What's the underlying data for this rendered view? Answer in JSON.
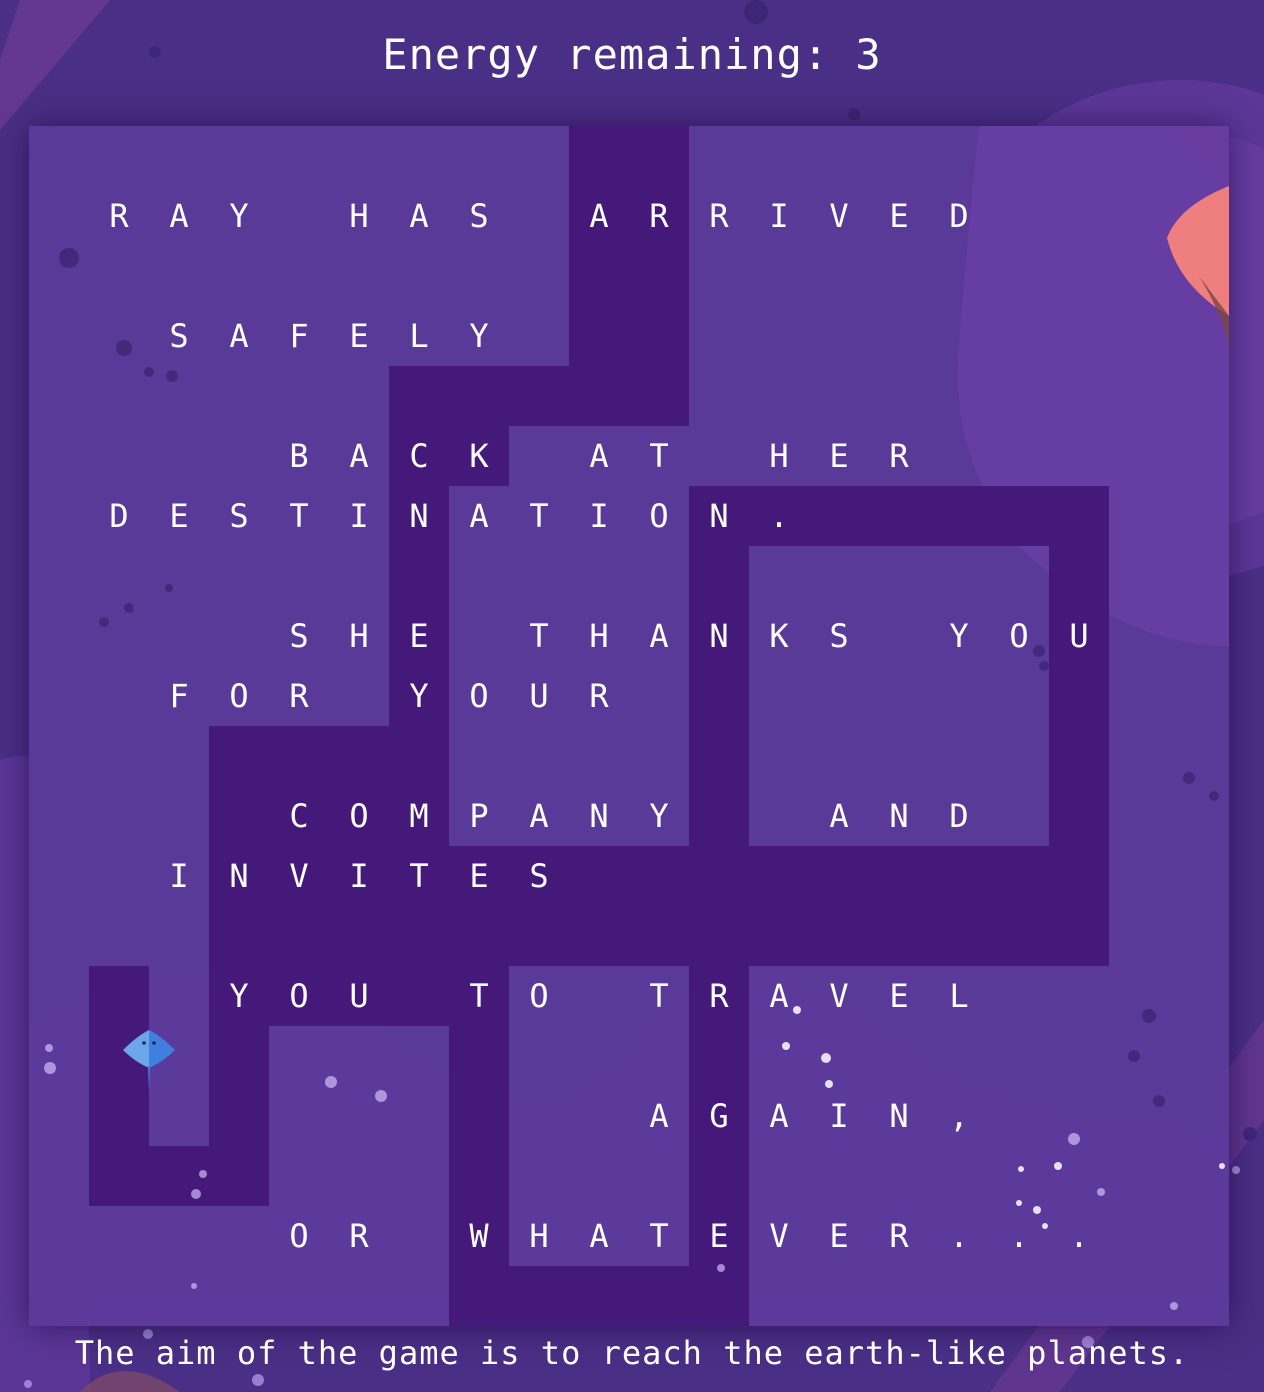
{
  "hud": {
    "energy_text": "Energy remaining: 3"
  },
  "board": {
    "message_lines": [
      {
        "row": 1,
        "col": 1,
        "text": "RAY HAS ARRIVED"
      },
      {
        "row": 3,
        "col": 2,
        "text": "SAFELY"
      },
      {
        "row": 5,
        "col": 4,
        "text": "BACK AT HER"
      },
      {
        "row": 6,
        "col": 1,
        "text": "DESTINATION."
      },
      {
        "row": 8,
        "col": 4,
        "text": "SHE THANKS YOU"
      },
      {
        "row": 9,
        "col": 2,
        "text": "FOR YOUR"
      },
      {
        "row": 11,
        "col": 4,
        "text": "COMPANY  AND"
      },
      {
        "row": 12,
        "col": 2,
        "text": "INVITES"
      },
      {
        "row": 14,
        "col": 3,
        "text": "YOU TO TRAVEL"
      },
      {
        "row": 16,
        "col": 10,
        "text": "AGAIN,"
      },
      {
        "row": 18,
        "col": 4,
        "text": "OR WHATEVER..."
      }
    ],
    "path_cells": [
      [
        9,
        0
      ],
      [
        10,
        0
      ],
      [
        9,
        1
      ],
      [
        10,
        1
      ],
      [
        9,
        2
      ],
      [
        10,
        2
      ],
      [
        9,
        3
      ],
      [
        10,
        3
      ],
      [
        9,
        4
      ],
      [
        10,
        4
      ],
      [
        6,
        4
      ],
      [
        7,
        4
      ],
      [
        8,
        4
      ],
      [
        6,
        5
      ],
      [
        7,
        5
      ],
      [
        6,
        6
      ],
      [
        6,
        7
      ],
      [
        6,
        8
      ],
      [
        6,
        9
      ],
      [
        6,
        10
      ],
      [
        6,
        11
      ],
      [
        3,
        10
      ],
      [
        4,
        10
      ],
      [
        5,
        10
      ],
      [
        3,
        11
      ],
      [
        4,
        11
      ],
      [
        5,
        11
      ],
      [
        3,
        12
      ],
      [
        4,
        12
      ],
      [
        5,
        12
      ],
      [
        6,
        12
      ],
      [
        7,
        12
      ],
      [
        8,
        12
      ],
      [
        9,
        12
      ],
      [
        10,
        12
      ],
      [
        11,
        12
      ],
      [
        12,
        12
      ],
      [
        13,
        12
      ],
      [
        14,
        12
      ],
      [
        15,
        12
      ],
      [
        16,
        12
      ],
      [
        17,
        12
      ],
      [
        3,
        13
      ],
      [
        4,
        13
      ],
      [
        5,
        13
      ],
      [
        6,
        13
      ],
      [
        7,
        13
      ],
      [
        8,
        13
      ],
      [
        9,
        13
      ],
      [
        10,
        13
      ],
      [
        11,
        13
      ],
      [
        12,
        13
      ],
      [
        13,
        13
      ],
      [
        14,
        13
      ],
      [
        15,
        13
      ],
      [
        16,
        13
      ],
      [
        17,
        13
      ],
      [
        3,
        14
      ],
      [
        3,
        15
      ],
      [
        3,
        16
      ],
      [
        11,
        6
      ],
      [
        11,
        7
      ],
      [
        11,
        8
      ],
      [
        11,
        9
      ],
      [
        11,
        10
      ],
      [
        11,
        11
      ],
      [
        11,
        14
      ],
      [
        11,
        15
      ],
      [
        11,
        16
      ],
      [
        11,
        17
      ],
      [
        11,
        18
      ],
      [
        11,
        19
      ],
      [
        12,
        6
      ],
      [
        13,
        6
      ],
      [
        14,
        6
      ],
      [
        15,
        6
      ],
      [
        16,
        6
      ],
      [
        17,
        6
      ],
      [
        17,
        7
      ],
      [
        17,
        8
      ],
      [
        17,
        9
      ],
      [
        17,
        10
      ],
      [
        17,
        11
      ],
      [
        1,
        14
      ],
      [
        1,
        15
      ],
      [
        1,
        16
      ],
      [
        1,
        17
      ],
      [
        2,
        17
      ],
      [
        3,
        17
      ],
      [
        4,
        14
      ],
      [
        5,
        14
      ],
      [
        6,
        14
      ],
      [
        7,
        14
      ],
      [
        7,
        15
      ],
      [
        7,
        16
      ],
      [
        7,
        17
      ],
      [
        7,
        18
      ],
      [
        7,
        19
      ],
      [
        8,
        19
      ],
      [
        9,
        19
      ],
      [
        10,
        19
      ]
    ],
    "player": "stingray-icon"
  },
  "colors": {
    "background": "#4a2f86",
    "board": "#5a3a98",
    "path": "#44197a"
  },
  "footer": {
    "text": "The aim of the game is to reach the earth-like planets."
  }
}
